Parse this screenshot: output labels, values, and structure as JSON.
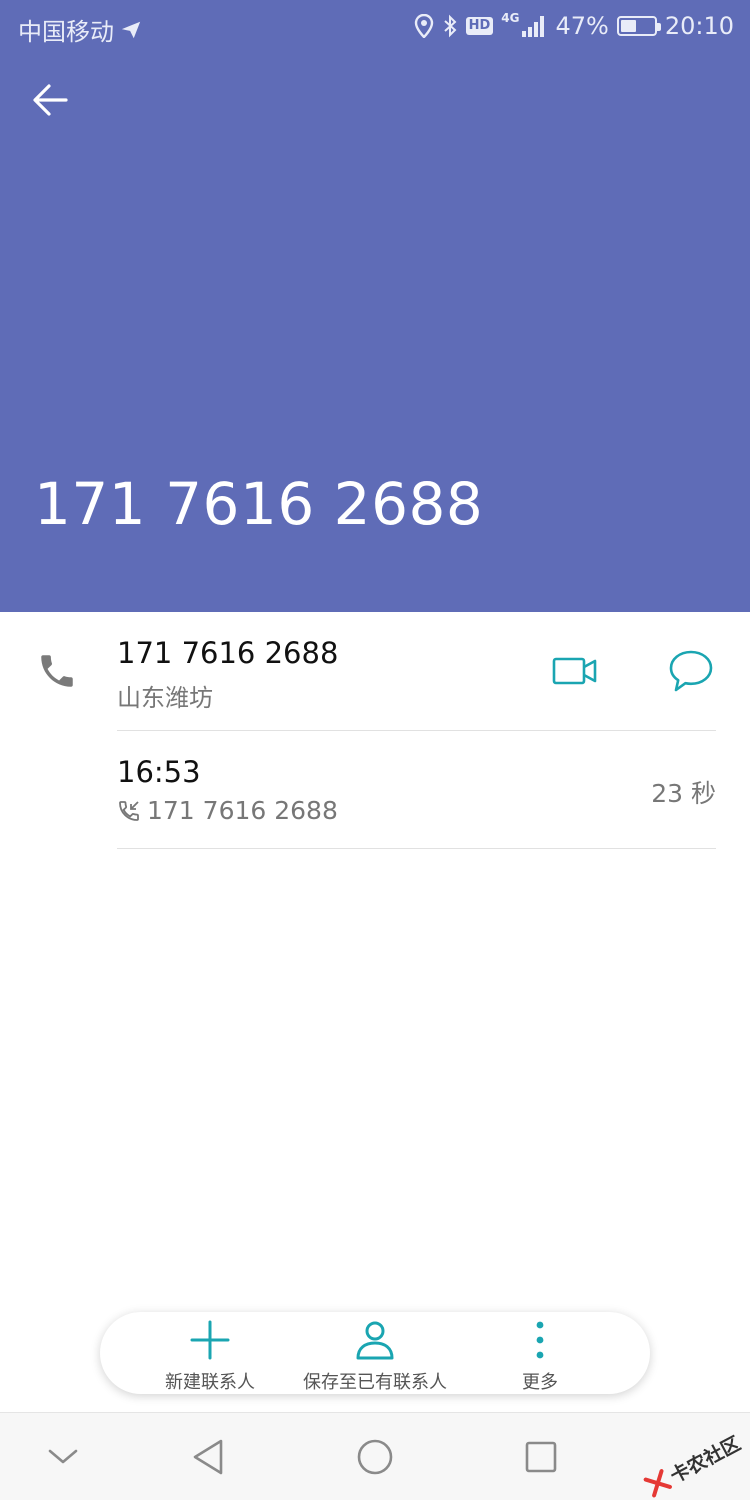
{
  "status_bar": {
    "carrier": "中国移动",
    "hd_label": "HD",
    "network_label": "4G",
    "battery_percent": "47%",
    "battery_level": 0.47,
    "time": "20:10"
  },
  "header": {
    "phone_number": "171 7616 2688",
    "background_color": "#5f6cb7"
  },
  "contact": {
    "number": "171 7616 2688",
    "location": "山东潍坊"
  },
  "call_log": [
    {
      "time": "16:53",
      "number": "171 7616 2688",
      "duration": "23 秒"
    }
  ],
  "actions": {
    "new_contact": "新建联系人",
    "save_existing": "保存至已有联系人",
    "more": "更多"
  },
  "accent_color": "#1aa5b1",
  "watermark": {
    "text": "卡农社区"
  },
  "icons": {
    "back": "arrow-left-icon",
    "phone": "phone-icon",
    "video": "video-camera-icon",
    "message": "message-bubble-icon",
    "add": "plus-icon",
    "person": "person-icon",
    "more": "more-vertical-icon"
  }
}
